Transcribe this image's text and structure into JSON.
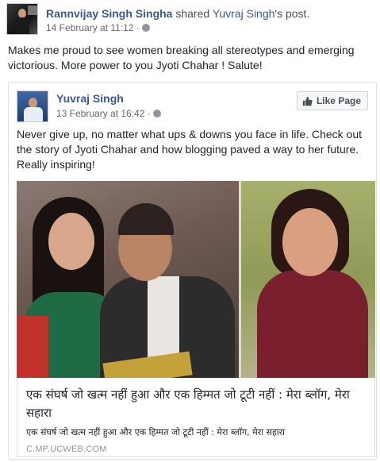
{
  "outer_post": {
    "author": "Rannvijay Singh Singha",
    "action_text": "shared",
    "shared_from": "Yuvraj Singh",
    "shared_suffix": "'s post.",
    "timestamp": "14 February at 11:12 ·",
    "privacy_icon": "globe-icon",
    "text": "Makes me proud to see women breaking all stereotypes and emerging victorious. More power to you Jyoti Chahar ! Salute!"
  },
  "shared_post": {
    "author": "Yuvraj Singh",
    "timestamp": "13 February at 16:42 ·",
    "privacy_icon": "globe-icon",
    "like_page_label": "Like Page",
    "text": "Never give up, no matter what ups & downs you face in life. Check out the story of Jyoti Chahar and how blogging paved a way to her future. Really inspiring!",
    "link": {
      "title": "एक संघर्ष जो खत्म नहीं हुआ और एक हिम्मत जो टूटी नहीं : मेरा ब्लॉग, मेरा सहारा",
      "description": "एक संघर्ष जो खत्म नहीं हुआ और एक हिम्मत जो टूटी नहीं : मेरा ब्लॉग, मेरा सहारा",
      "domain": "C.MP.UCWEB.COM"
    }
  },
  "colors": {
    "link_blue": "#365899",
    "meta_gray": "#616770",
    "border": "#dddfe2"
  }
}
